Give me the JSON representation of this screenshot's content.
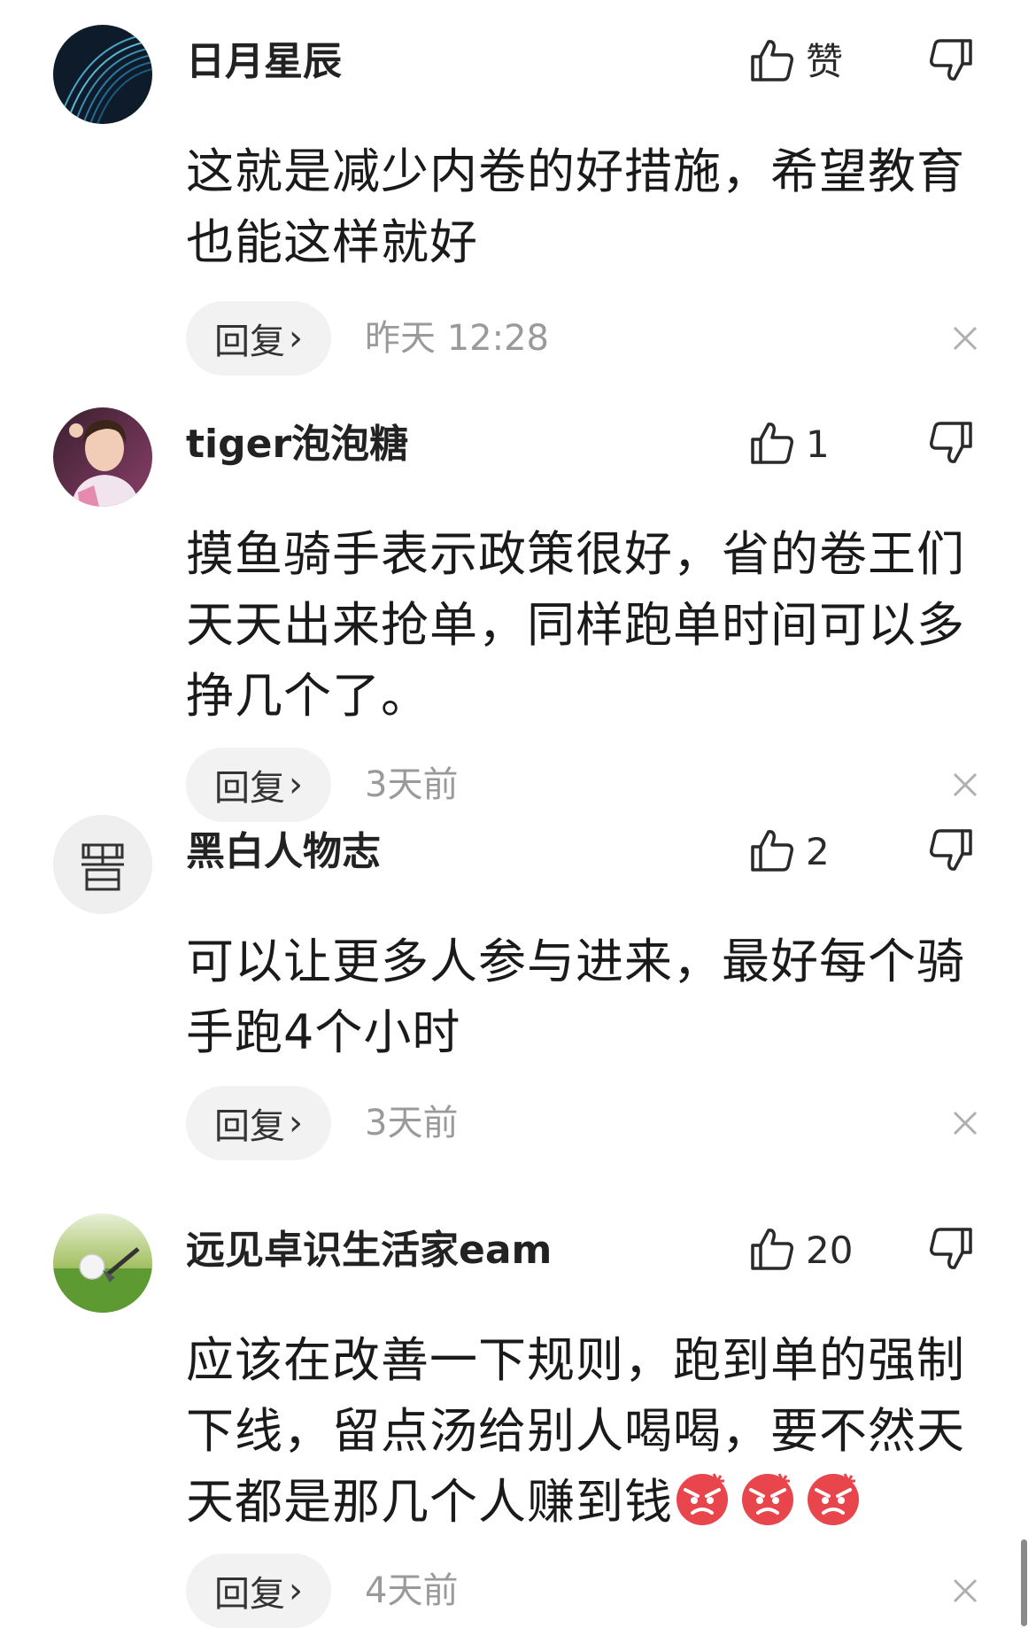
{
  "comments": [
    {
      "username": "日月星辰",
      "like_label": "赞",
      "text": "这就是减少内卷的好措施，希望教育也能这样就好",
      "reply_label": "回复",
      "time": "昨天 12:28",
      "avatar": "dark-wave-avatar"
    },
    {
      "username": "tiger泡泡糖",
      "like_label": "1",
      "text": "摸鱼骑手表示政策很好，省的卷王们天天出来抢单，同样跑单时间可以多挣几个了。",
      "reply_label": "回复",
      "time": "3天前",
      "avatar": "girl-photo-avatar"
    },
    {
      "username": "黑白人物志",
      "like_label": "2",
      "text": "可以让更多人参与进来，最好每个骑手跑4个小时",
      "reply_label": "回复",
      "time": "3天前",
      "avatar": "logo-avatar",
      "avatar_text": "黑白"
    },
    {
      "username": "远见卓识生活家eam",
      "like_label": "20",
      "text": "应该在改善一下规则，跑到单的强制下线，留点汤给别人喝喝，要不然天天都是那几个人赚到钱",
      "text_emojis": [
        "angry-face-emoji",
        "angry-face-emoji",
        "angry-face-emoji"
      ],
      "reply_label": "回复",
      "time": "4天前",
      "avatar": "golf-ball-avatar"
    }
  ],
  "icons": {
    "like": "thumbs-up-icon",
    "dislike": "thumbs-down-icon",
    "reply_chevron": "chevron-right-icon",
    "close": "close-icon"
  },
  "colors": {
    "text": "#1a1a1a",
    "secondary": "#9a9a9a",
    "reply_bg": "#f2f2f2",
    "emoji": "#e8454c"
  }
}
